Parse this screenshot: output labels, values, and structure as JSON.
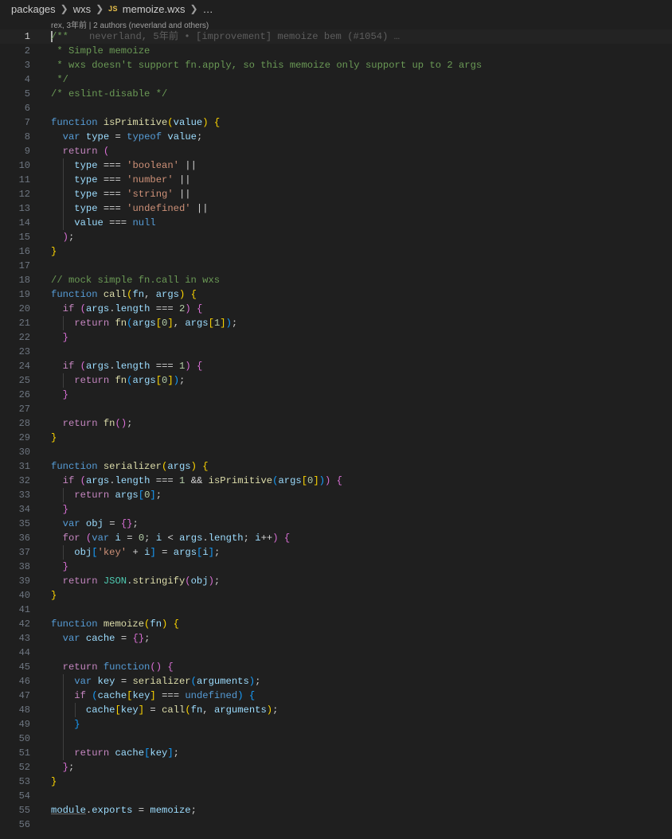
{
  "breadcrumb": {
    "segments": [
      "packages",
      "wxs"
    ],
    "file_icon": "JS",
    "file_name": "memoize.wxs",
    "trailing": "…"
  },
  "codelens": "rex, 3年前 | 2 authors (neverland and others)",
  "blame_line1": "neverland, 5年前 • [improvement] memoize bem (#1054) …",
  "line_numbers": [
    "1",
    "2",
    "3",
    "4",
    "5",
    "6",
    "7",
    "8",
    "9",
    "10",
    "11",
    "12",
    "13",
    "14",
    "15",
    "16",
    "17",
    "18",
    "19",
    "20",
    "21",
    "22",
    "23",
    "24",
    "25",
    "26",
    "27",
    "28",
    "29",
    "30",
    "31",
    "32",
    "33",
    "34",
    "35",
    "36",
    "37",
    "38",
    "39",
    "40",
    "41",
    "42",
    "43",
    "44",
    "45",
    "46",
    "47",
    "48",
    "49",
    "50",
    "51",
    "52",
    "53",
    "54",
    "55",
    "56"
  ],
  "colors": {
    "background": "#1f1f1f",
    "keyword": "#569cd6",
    "control": "#c586c0",
    "function": "#dcdcaa",
    "variable": "#9cdcfe",
    "string": "#ce9178",
    "number": "#b5cea8",
    "comment": "#6a9955"
  }
}
